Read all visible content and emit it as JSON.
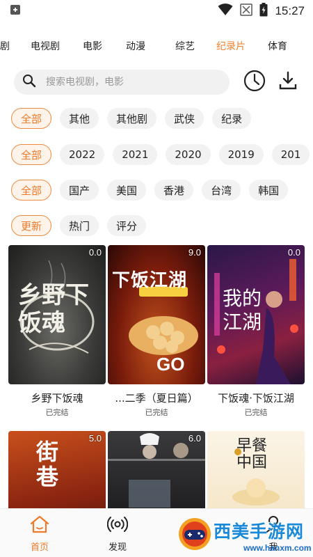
{
  "status_bar": {
    "time": "15:27"
  },
  "tabs": [
    {
      "label": "剧",
      "active": false
    },
    {
      "label": "电视剧",
      "active": false
    },
    {
      "label": "电影",
      "active": false
    },
    {
      "label": "动漫",
      "active": false
    },
    {
      "label": "综艺",
      "active": false
    },
    {
      "label": "纪录片",
      "active": true
    },
    {
      "label": "体育",
      "active": false
    }
  ],
  "search": {
    "placeholder": "搜索电视剧，电影"
  },
  "filters": {
    "genre": [
      "全部",
      "其他",
      "其他剧",
      "武侠",
      "纪录"
    ],
    "year": [
      "全部",
      "2022",
      "2021",
      "2020",
      "2019",
      "201"
    ],
    "region": [
      "全部",
      "国产",
      "美国",
      "香港",
      "台湾",
      "韩国"
    ],
    "sort": [
      "更新",
      "热门",
      "评分"
    ]
  },
  "cards": [
    {
      "title": "乡野下饭魂",
      "score": "0.0",
      "status": "已完结",
      "poster_text": "乡野下饭魂"
    },
    {
      "title": "...二季（夏日篇）",
      "score": "9.0",
      "status": "已完结",
      "poster_text": "下饭江湖"
    },
    {
      "title": "下饭魂·下饭江湖",
      "score": "0.0",
      "status": "已完结",
      "poster_text": "我的江湖"
    },
    {
      "title": "",
      "score": "5.0",
      "status": "",
      "poster_text": "街巷"
    },
    {
      "title": "",
      "score": "6.0",
      "status": "",
      "poster_text": ""
    },
    {
      "title": "",
      "score": "",
      "status": "",
      "poster_text": "早餐中国"
    }
  ],
  "bottom_nav": [
    {
      "label": "首页",
      "icon": "home-icon",
      "active": true
    },
    {
      "label": "发现",
      "icon": "broadcast-icon",
      "active": false
    },
    {
      "label": "我",
      "icon": "person-icon",
      "active": false
    }
  ],
  "watermark": {
    "text": "西美手游网",
    "url": "www.hanxm.com"
  },
  "colors": {
    "accent": "#f08030",
    "chip_bg": "#f2f2f2",
    "selected_bg": "#fff3ea"
  }
}
